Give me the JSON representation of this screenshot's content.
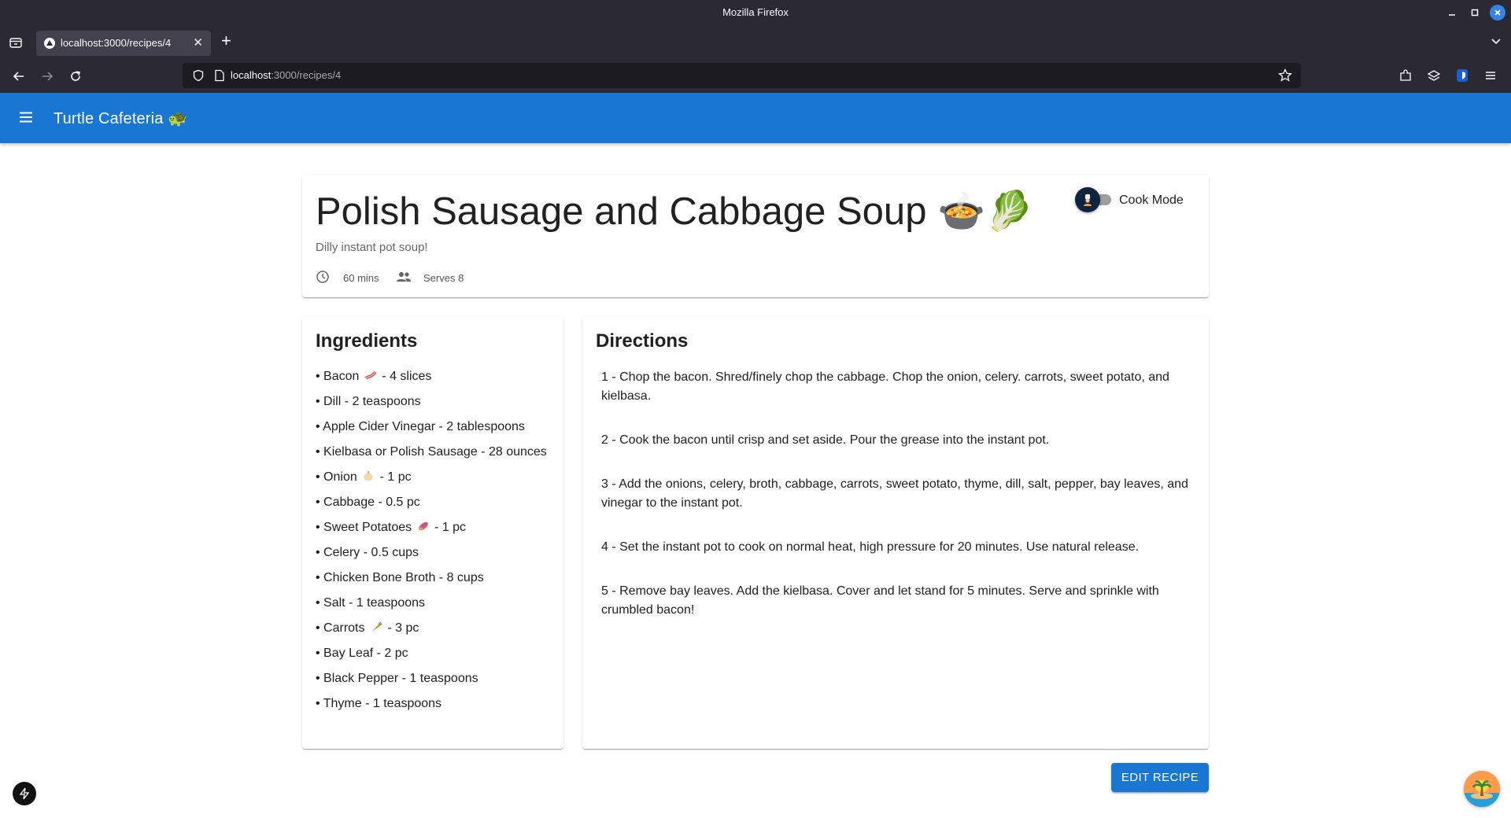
{
  "browser": {
    "window_title": "Mozilla Firefox",
    "tab_title": "localhost:3000/recipes/4",
    "url_host": "localhost",
    "url_rest": ":3000/recipes/4"
  },
  "app": {
    "brand": "Turtle Cafeteria 🐢",
    "accent_color": "#1976d2"
  },
  "recipe": {
    "title": "Polish Sausage and Cabbage Soup 🍲🥬",
    "subtitle": "Dilly instant pot soup!",
    "time": "60 mins",
    "serves": "Serves 8",
    "cook_mode_label": "Cook Mode",
    "cook_mode_on": false
  },
  "ingredients": {
    "heading": "Ingredients",
    "items": [
      {
        "before": "• Bacon ",
        "emoji": "bacon-icon",
        "after": " - 4 slices"
      },
      {
        "before": "• Dill - 2 teaspoons",
        "emoji": null,
        "after": ""
      },
      {
        "before": "• Apple Cider Vinegar - 2 tablespoons",
        "emoji": null,
        "after": ""
      },
      {
        "before": "• Kielbasa or Polish Sausage - 28 ounces",
        "emoji": null,
        "after": ""
      },
      {
        "before": "• Onion ",
        "emoji": "onion-icon",
        "after": " - 1 pc"
      },
      {
        "before": "• Cabbage - 0.5 pc",
        "emoji": null,
        "after": ""
      },
      {
        "before": "• Sweet Potatoes ",
        "emoji": "sweet-potato-icon",
        "after": " - 1 pc"
      },
      {
        "before": "• Celery - 0.5 cups",
        "emoji": null,
        "after": ""
      },
      {
        "before": "• Chicken Bone Broth - 8 cups",
        "emoji": null,
        "after": ""
      },
      {
        "before": "• Salt - 1 teaspoons",
        "emoji": null,
        "after": ""
      },
      {
        "before": "• Carrots ",
        "emoji": "carrot-icon",
        "after": " - 3 pc"
      },
      {
        "before": "• Bay Leaf - 2 pc",
        "emoji": null,
        "after": ""
      },
      {
        "before": "• Black Pepper - 1 teaspoons",
        "emoji": null,
        "after": ""
      },
      {
        "before": "• Thyme - 1 teaspoons",
        "emoji": null,
        "after": ""
      }
    ]
  },
  "directions": {
    "heading": "Directions",
    "steps": [
      "1 - Chop the bacon. Shred/finely chop the cabbage. Chop the onion, celery. carrots, sweet potato, and kielbasa.",
      "2 - Cook the bacon until crisp and set aside. Pour the grease into the instant pot.",
      "3 - Add the onions, celery, broth, cabbage, carrots, sweet potato, thyme, dill, salt, pepper, bay leaves, and vinegar to the instant pot.",
      "4 - Set the instant pot to cook on normal heat, high pressure for 20 minutes. Use natural release.",
      "5 - Remove bay leaves. Add the kielbasa. Cover and let stand for 5 minutes. Serve and sprinkle with crumbled bacon!"
    ]
  },
  "actions": {
    "edit_label": "EDIT RECIPE"
  }
}
